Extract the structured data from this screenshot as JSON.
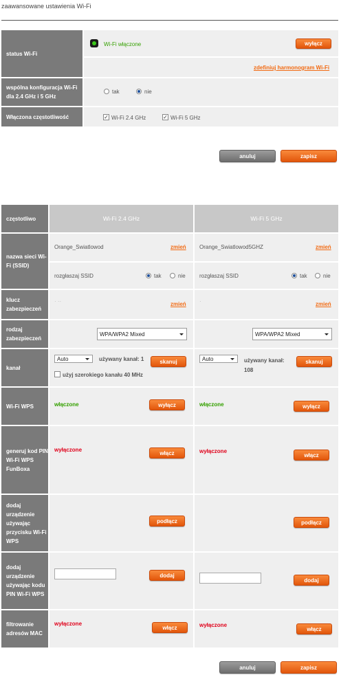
{
  "page_title": "zaawansowane ustawienia Wi-Fi",
  "general": {
    "status_label": "status Wi-Fi",
    "status_text": "Wi-Fi włączone",
    "off_button": "wyłącz",
    "schedule_link": "zdefiniuj harmonogram Wi-Fi",
    "shared_config_label": "wspólna konfiguracja Wi-Fi dla 2.4 GHz i 5 GHz",
    "yes": "tak",
    "no": "nie",
    "freq_label": "Włączona częstotliwość",
    "freq_24": "Wi-Fi 2.4 GHz",
    "freq_5": "Wi-Fi 5 GHz",
    "cancel": "anuluj",
    "save": "zapisz"
  },
  "bands": {
    "header_label": "częstotliwo",
    "ssid_label": "nazwa sieci Wi-Fi (SSID)",
    "broadcast_label": "rozgłaszaj SSID",
    "key_label": "klucz zabezpieczeń",
    "security_type_label": "rodzaj zabezpieczeń",
    "channel_label": "kanał",
    "wps_label": "Wi-Fi WPS",
    "gen_pin_label": "generuj kod PIN Wi-Fi WPS FunBoxa",
    "add_button_label": "dodaj urządzenie używając przycisku Wi-Fi WPS",
    "add_pin_label": "dodaj urządzenie używając kodu PIN Wi-Fi WPS",
    "mac_label": "filtrowanie adresów MAC",
    "change_link": "zmień",
    "yes": "tak",
    "no": "nie",
    "wide_channel": "użyj szerokiego kanału 40 MHz",
    "scan_button": "skanuj",
    "off_button": "wyłącz",
    "on_button": "włącz",
    "connect_button": "podłącz",
    "add_button": "dodaj",
    "cancel": "anuluj",
    "save": "zapisz",
    "band24": {
      "name": "Wi-Fi 2.4 GHz",
      "ssid": "Orange_Swiatlowod",
      "key_masked": "·    ··",
      "security": "WPA/WPA2 Mixed",
      "channel_select": "Auto",
      "channel_used": "używany kanał: 1",
      "wps_status": "włączone",
      "pin_status": "wyłączone",
      "mac_status": "wyłączone"
    },
    "band5": {
      "name": "Wi-Fi 5 GHz",
      "ssid": "Orange_Swiatlowod5GHZ",
      "key_masked": "·",
      "security": "WPA/WPA2 Mixed",
      "channel_select": "Auto",
      "channel_used": "używany kanał: 108",
      "wps_status": "włączone",
      "pin_status": "wyłączone",
      "mac_status": "wyłączone"
    }
  }
}
